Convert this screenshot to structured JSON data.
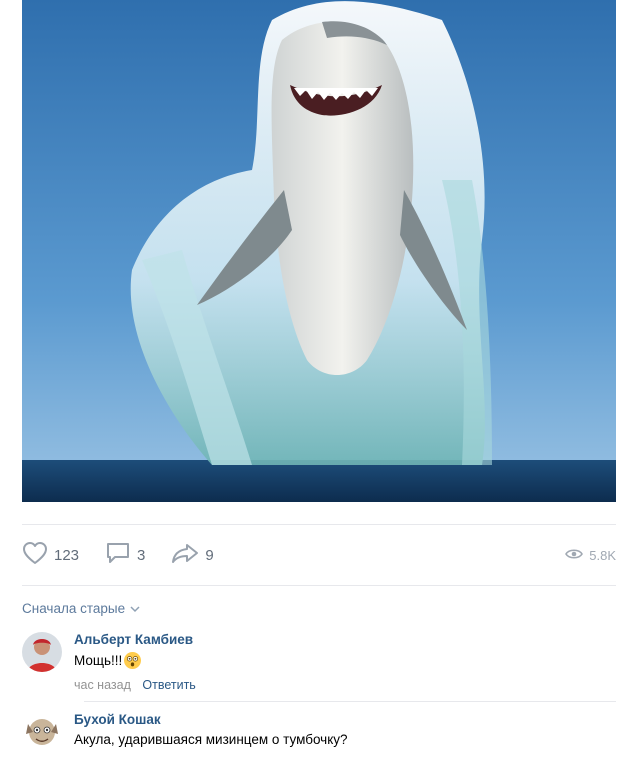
{
  "post": {
    "image": {
      "subject": "shark-breaching-photo"
    },
    "actions": {
      "likes": "123",
      "comments": "3",
      "shares": "9",
      "views": "5.8K"
    }
  },
  "comments_section": {
    "sort_label": "Сначала старые",
    "items": [
      {
        "author": "Альберт Камбиев",
        "text": "Мощь!!!",
        "time": "час назад",
        "reply": "Ответить"
      },
      {
        "author": "Бухой Кошак",
        "text": "Акула, ударившаяся мизинцем о тумбочку?"
      }
    ]
  },
  "colors": {
    "link": "#2a5885",
    "muted": "#818c99",
    "sort": "#5d7a9c"
  }
}
